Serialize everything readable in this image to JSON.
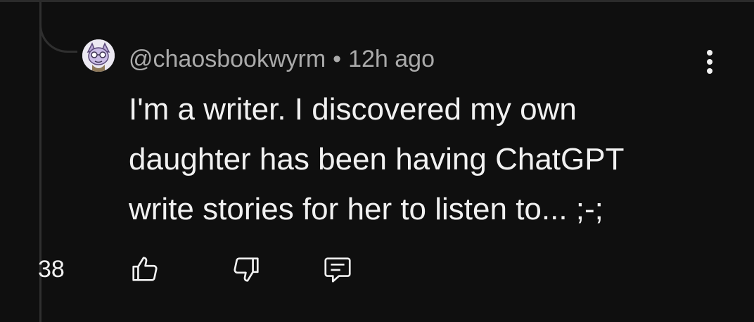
{
  "comment": {
    "handle": "@chaosbookwyrm",
    "separator": "•",
    "time": "12h ago",
    "lines": [
      "I'm a writer. I discovered my own",
      "daughter has been having ChatGPT",
      "write stories for her to listen to... ;-;"
    ],
    "like_count": "38"
  },
  "icons": {
    "avatar": "avatar",
    "more": "more-vertical-icon",
    "like": "thumbs-up-icon",
    "dislike": "thumbs-down-icon",
    "reply": "comment-icon"
  },
  "colors": {
    "background": "#0f0f0f",
    "primary_text": "#f1f1f1",
    "secondary_text": "#aaaaaa",
    "thread_line": "#2f2f2f"
  }
}
